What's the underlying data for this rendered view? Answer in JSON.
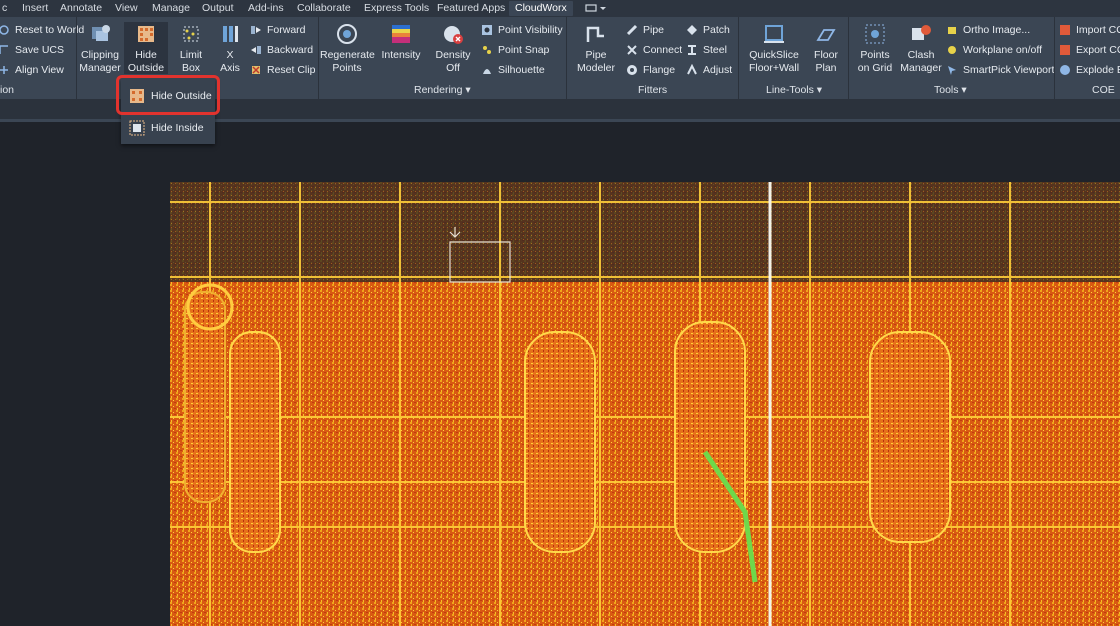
{
  "tabs": [
    "c",
    "Insert",
    "Annotate",
    "View",
    "Manage",
    "Output",
    "Add-ins",
    "Collaborate",
    "Express Tools",
    "Featured Apps",
    "CloudWorx"
  ],
  "active_tab": "CloudWorx",
  "ribbon": {
    "ucs": {
      "reset": "Reset to World",
      "save": "Save UCS",
      "align": "Align View",
      "title": "ion"
    },
    "clipping": {
      "manager": [
        "Clipping",
        "Manager"
      ],
      "hide": [
        "Hide",
        "Outside"
      ],
      "limit": [
        "Limit",
        "Box"
      ],
      "axis": [
        "X",
        "Axis"
      ],
      "forward": "Forward",
      "backward": "Backward",
      "reset": "Reset Clip"
    },
    "rendering": {
      "regen": [
        "Regenerate",
        "Points"
      ],
      "intensity": "Intensity",
      "density": [
        "Density",
        "Off"
      ],
      "visibility": "Point Visibility",
      "snap": "Point Snap",
      "silhouette": "Silhouette",
      "title": "Rendering"
    },
    "fitters": {
      "pipe_modeler": [
        "Pipe",
        "Modeler"
      ],
      "pipe": "Pipe",
      "connect": "Connect",
      "flange": "Flange",
      "patch": "Patch",
      "steel": "Steel",
      "adjust": "Adjust",
      "title": "Fitters"
    },
    "linetools": {
      "quickslice": [
        "QuickSlice",
        "Floor+Wall"
      ],
      "floorplan": [
        "Floor",
        "Plan"
      ],
      "title": "Line-Tools"
    },
    "tools": {
      "grid": [
        "Points",
        "on Grid"
      ],
      "clash": [
        "Clash",
        "Manager"
      ],
      "ortho": "Ortho Image...",
      "workplane": "Workplane on/off",
      "smartpick": "SmartPick Viewport",
      "title": "Tools"
    },
    "coe": {
      "import": "Import CO",
      "export": "Export CO",
      "explode": "Explode B",
      "title": "COE"
    }
  },
  "dropdown": {
    "hide_outside": "Hide Outside",
    "hide_inside": "Hide Inside"
  },
  "colors": {
    "highlight": "#e2332e",
    "ribbon": "#3b4654",
    "tabbar": "#2d3540"
  }
}
